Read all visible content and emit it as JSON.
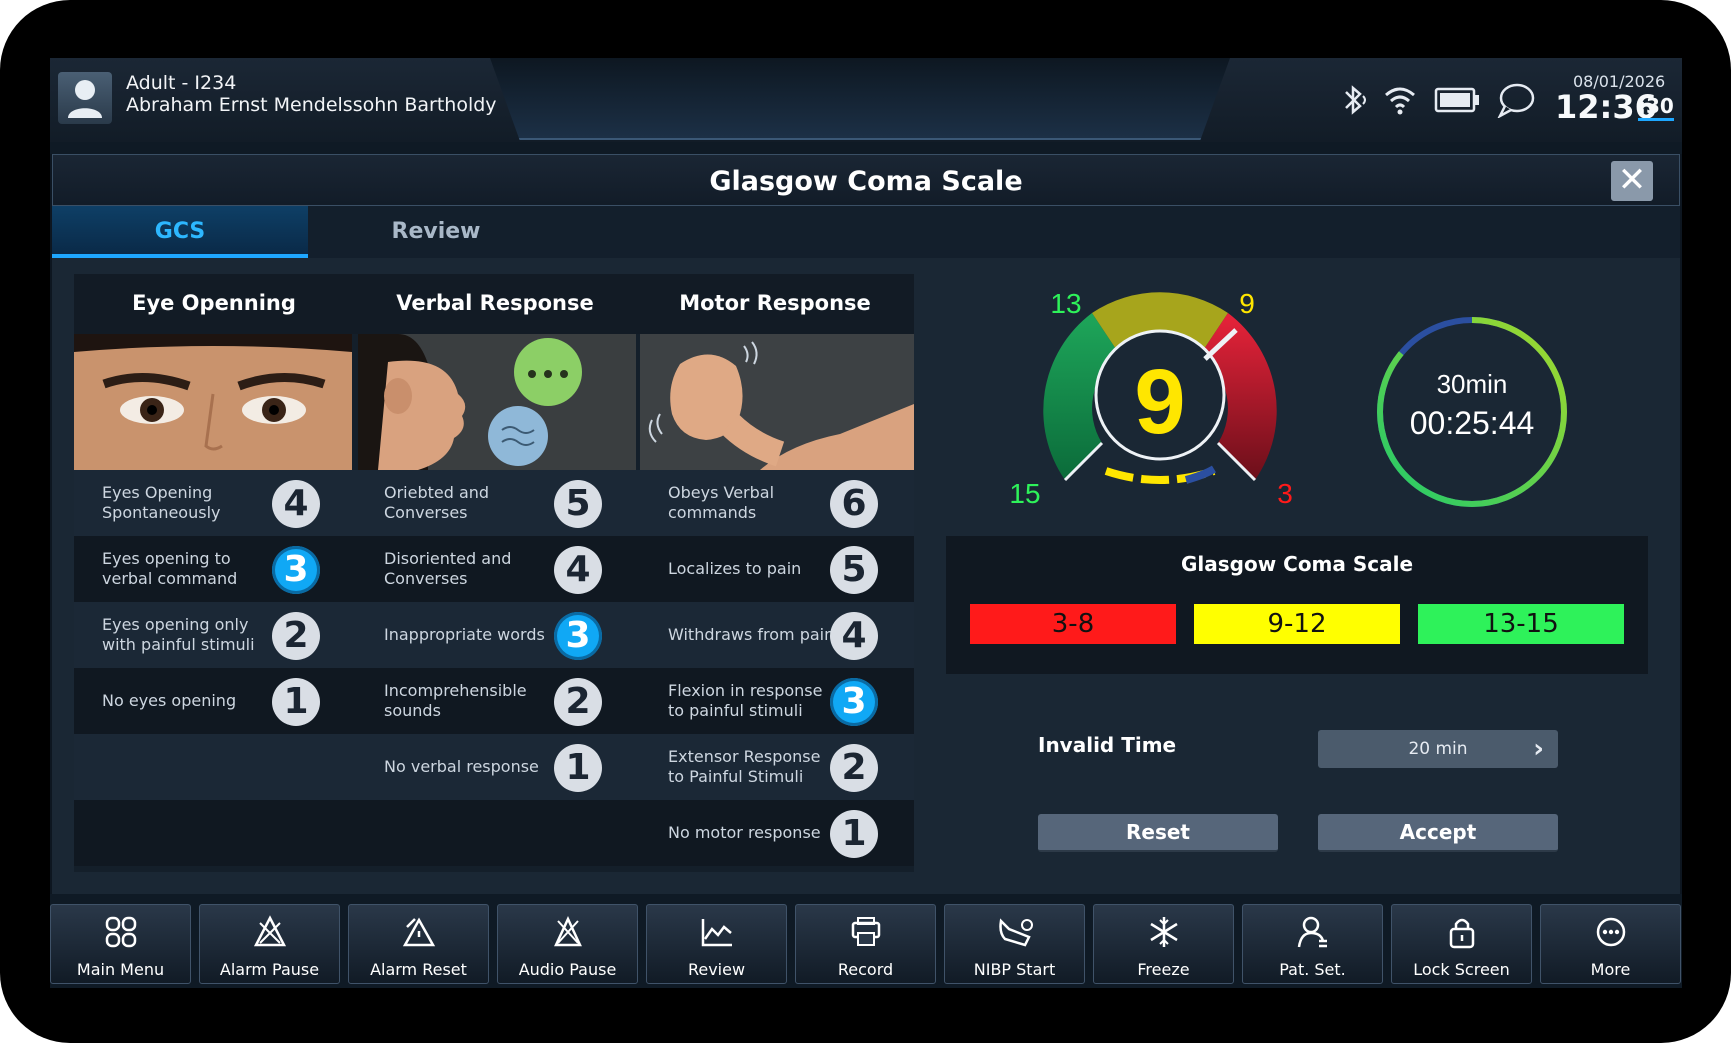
{
  "patient": {
    "type_id": "Adult - I234",
    "name": "Abraham Ernst Mendelssohn Bartholdy"
  },
  "status": {
    "date": "08/01/2026",
    "time": "12:36",
    "seconds": ":30",
    "icons": [
      "bluetooth-icon",
      "wifi-icon",
      "battery-icon",
      "message-icon"
    ]
  },
  "dialog": {
    "title": "Glasgow Coma Scale",
    "close_label": "✕"
  },
  "tabs": [
    {
      "label": "GCS",
      "active": true
    },
    {
      "label": "Review",
      "active": false
    }
  ],
  "columns": [
    {
      "heading": "Eye Openning",
      "options": [
        {
          "label": "Eyes Opening Spontaneously",
          "score": "4",
          "selected": false
        },
        {
          "label": "Eyes opening to verbal command",
          "score": "3",
          "selected": true
        },
        {
          "label": "Eyes opening only with painful stimuli",
          "score": "2",
          "selected": false
        },
        {
          "label": "No eyes opening",
          "score": "1",
          "selected": false
        }
      ]
    },
    {
      "heading": "Verbal Response",
      "options": [
        {
          "label": "Oriebted and Converses",
          "score": "5",
          "selected": false
        },
        {
          "label": "Disoriented and Converses",
          "score": "4",
          "selected": false
        },
        {
          "label": "Inappropriate words",
          "score": "3",
          "selected": true
        },
        {
          "label": "Incomprehensible sounds",
          "score": "2",
          "selected": false
        },
        {
          "label": "No verbal response",
          "score": "1",
          "selected": false
        }
      ]
    },
    {
      "heading": "Motor Response",
      "options": [
        {
          "label": "Obeys Verbal commands",
          "score": "6",
          "selected": false
        },
        {
          "label": "Localizes to pain",
          "score": "5",
          "selected": false
        },
        {
          "label": "Withdraws from pain",
          "score": "4",
          "selected": false
        },
        {
          "label": "Flexion in response to painful stimuli",
          "score": "3",
          "selected": true
        },
        {
          "label": "Extensor Response to Painful Stimuli",
          "score": "2",
          "selected": false
        },
        {
          "label": "No motor response",
          "score": "1",
          "selected": false
        }
      ]
    }
  ],
  "gauge": {
    "value": "9",
    "label_13": "13",
    "label_9": "9",
    "label_15": "15",
    "label_3": "3"
  },
  "timer": {
    "interval": "30min",
    "elapsed": "00:25:44",
    "progress": 0.86
  },
  "ranges": {
    "title": "Glasgow Coma Scale",
    "items": [
      {
        "label": "3-8",
        "color": "#ff1a1a"
      },
      {
        "label": "9-12",
        "color": "#ffff00"
      },
      {
        "label": "13-15",
        "color": "#2ef25a"
      }
    ]
  },
  "invalid_time": {
    "label": "Invalid Time",
    "value": "20 min"
  },
  "buttons": {
    "reset": "Reset",
    "accept": "Accept"
  },
  "function_keys": [
    {
      "label": "Main Menu",
      "icon": "main-menu-icon"
    },
    {
      "label": "Alarm Pause",
      "icon": "alarm-pause-icon"
    },
    {
      "label": "Alarm Reset",
      "icon": "alarm-reset-icon"
    },
    {
      "label": "Audio Pause",
      "icon": "audio-pause-icon"
    },
    {
      "label": "Review",
      "icon": "review-icon"
    },
    {
      "label": "Record",
      "icon": "record-icon"
    },
    {
      "label": "NIBP Start",
      "icon": "nibp-start-icon"
    },
    {
      "label": "Freeze",
      "icon": "freeze-icon"
    },
    {
      "label": "Pat. Set.",
      "icon": "patient-setup-icon"
    },
    {
      "label": "Lock Screen",
      "icon": "lock-icon"
    },
    {
      "label": "More",
      "icon": "more-icon"
    }
  ]
}
